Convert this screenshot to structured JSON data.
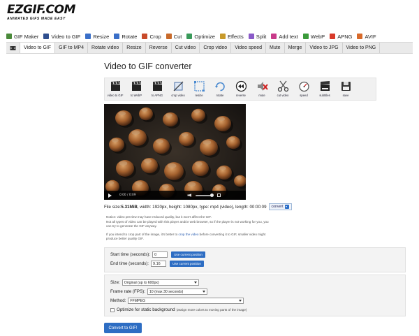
{
  "logo": {
    "main": "EZGIF.COM",
    "sub": "ANIMATED GIFS MADE EASY"
  },
  "main_nav": [
    {
      "label": "GIF Maker",
      "icon": "gif-maker-icon",
      "color": "#4a8a3a"
    },
    {
      "label": "Video to GIF",
      "icon": "video-icon",
      "color": "#2f4f8f"
    },
    {
      "label": "Resize",
      "icon": "resize-icon",
      "color": "#3a6fc8"
    },
    {
      "label": "Rotate",
      "icon": "rotate-icon",
      "color": "#3a6fc8"
    },
    {
      "label": "Crop",
      "icon": "crop-icon",
      "color": "#c84a2a"
    },
    {
      "label": "Cut",
      "icon": "cut-icon",
      "color": "#c86a2a"
    },
    {
      "label": "Optimize",
      "icon": "optimize-icon",
      "color": "#3a9a5a"
    },
    {
      "label": "Effects",
      "icon": "effects-icon",
      "color": "#c89a2a"
    },
    {
      "label": "Split",
      "icon": "split-icon",
      "color": "#8a5ac8"
    },
    {
      "label": "Add text",
      "icon": "add-text-icon",
      "color": "#c83a8a"
    },
    {
      "label": "WebP",
      "icon": "webp-icon",
      "color": "#3a9a3a"
    },
    {
      "label": "APNG",
      "icon": "apng-icon",
      "color": "#d83a2a"
    },
    {
      "label": "AVIF",
      "icon": "avif-icon",
      "color": "#d86a2a"
    }
  ],
  "sub_nav": [
    "Video to GIF",
    "GIF to MP4",
    "Rotate video",
    "Resize",
    "Reverse",
    "Cut video",
    "Crop video",
    "Video speed",
    "Mute",
    "Merge",
    "Video to JPG",
    "Video to PNG"
  ],
  "page_title": "Video to GIF converter",
  "tools": [
    {
      "label": "video to GIF",
      "icon": "clapperboard-icon"
    },
    {
      "label": "to WebP",
      "icon": "clapperboard-icon"
    },
    {
      "label": "to APNG",
      "icon": "clapperboard-icon"
    },
    {
      "label": "crop video",
      "icon": "crop-video-icon"
    },
    {
      "label": "resize",
      "icon": "resize-video-icon"
    },
    {
      "label": "rotate",
      "icon": "rotate-video-icon"
    },
    {
      "label": "reverse",
      "icon": "reverse-icon"
    },
    {
      "label": "mute",
      "icon": "mute-icon"
    },
    {
      "label": "cut video",
      "icon": "scissors-icon"
    },
    {
      "label": "speed",
      "icon": "speed-icon"
    },
    {
      "label": "subtitles",
      "icon": "subtitles-icon"
    },
    {
      "label": "save",
      "icon": "save-icon"
    }
  ],
  "video": {
    "time": "0:00   /   0:09"
  },
  "fileinfo": {
    "prefix": "File size: ",
    "size": "5.31MiB",
    "rest": ", width: 1920px, height: 1080px, type: mp4 (video), length: 00:00:09",
    "convert": "convert"
  },
  "notice": {
    "p1": "Notice: video preview may have reduced quality, but it won't affect the GIF.",
    "p2": "Not all types of video can be played with this player and/or web browser, so if the player is not working for you, you can try to generate the GIF anyway.",
    "p3a": "If you intend to crop part of the image, it's better to ",
    "p3link": "crop the video",
    "p3b": " before converting it to GIF, smaller video might produce better quality GIF."
  },
  "form": {
    "start_label": "Start time (seconds):",
    "start_value": "0",
    "end_label": "End time (seconds):",
    "end_value": "9.16",
    "use_pos": "Use current position",
    "size_label": "Size:",
    "size_value": "Original (up to 600px)",
    "fps_label": "Frame rate (FPS):",
    "fps_value": "10 (max 30 seconds)",
    "method_label": "Method:",
    "method_value": "FFMPEG",
    "optimize_label": "Optimize for static background",
    "optimize_hint": "(assign more colors to moving parts of the image)",
    "submit": "Convert to GIF!"
  }
}
